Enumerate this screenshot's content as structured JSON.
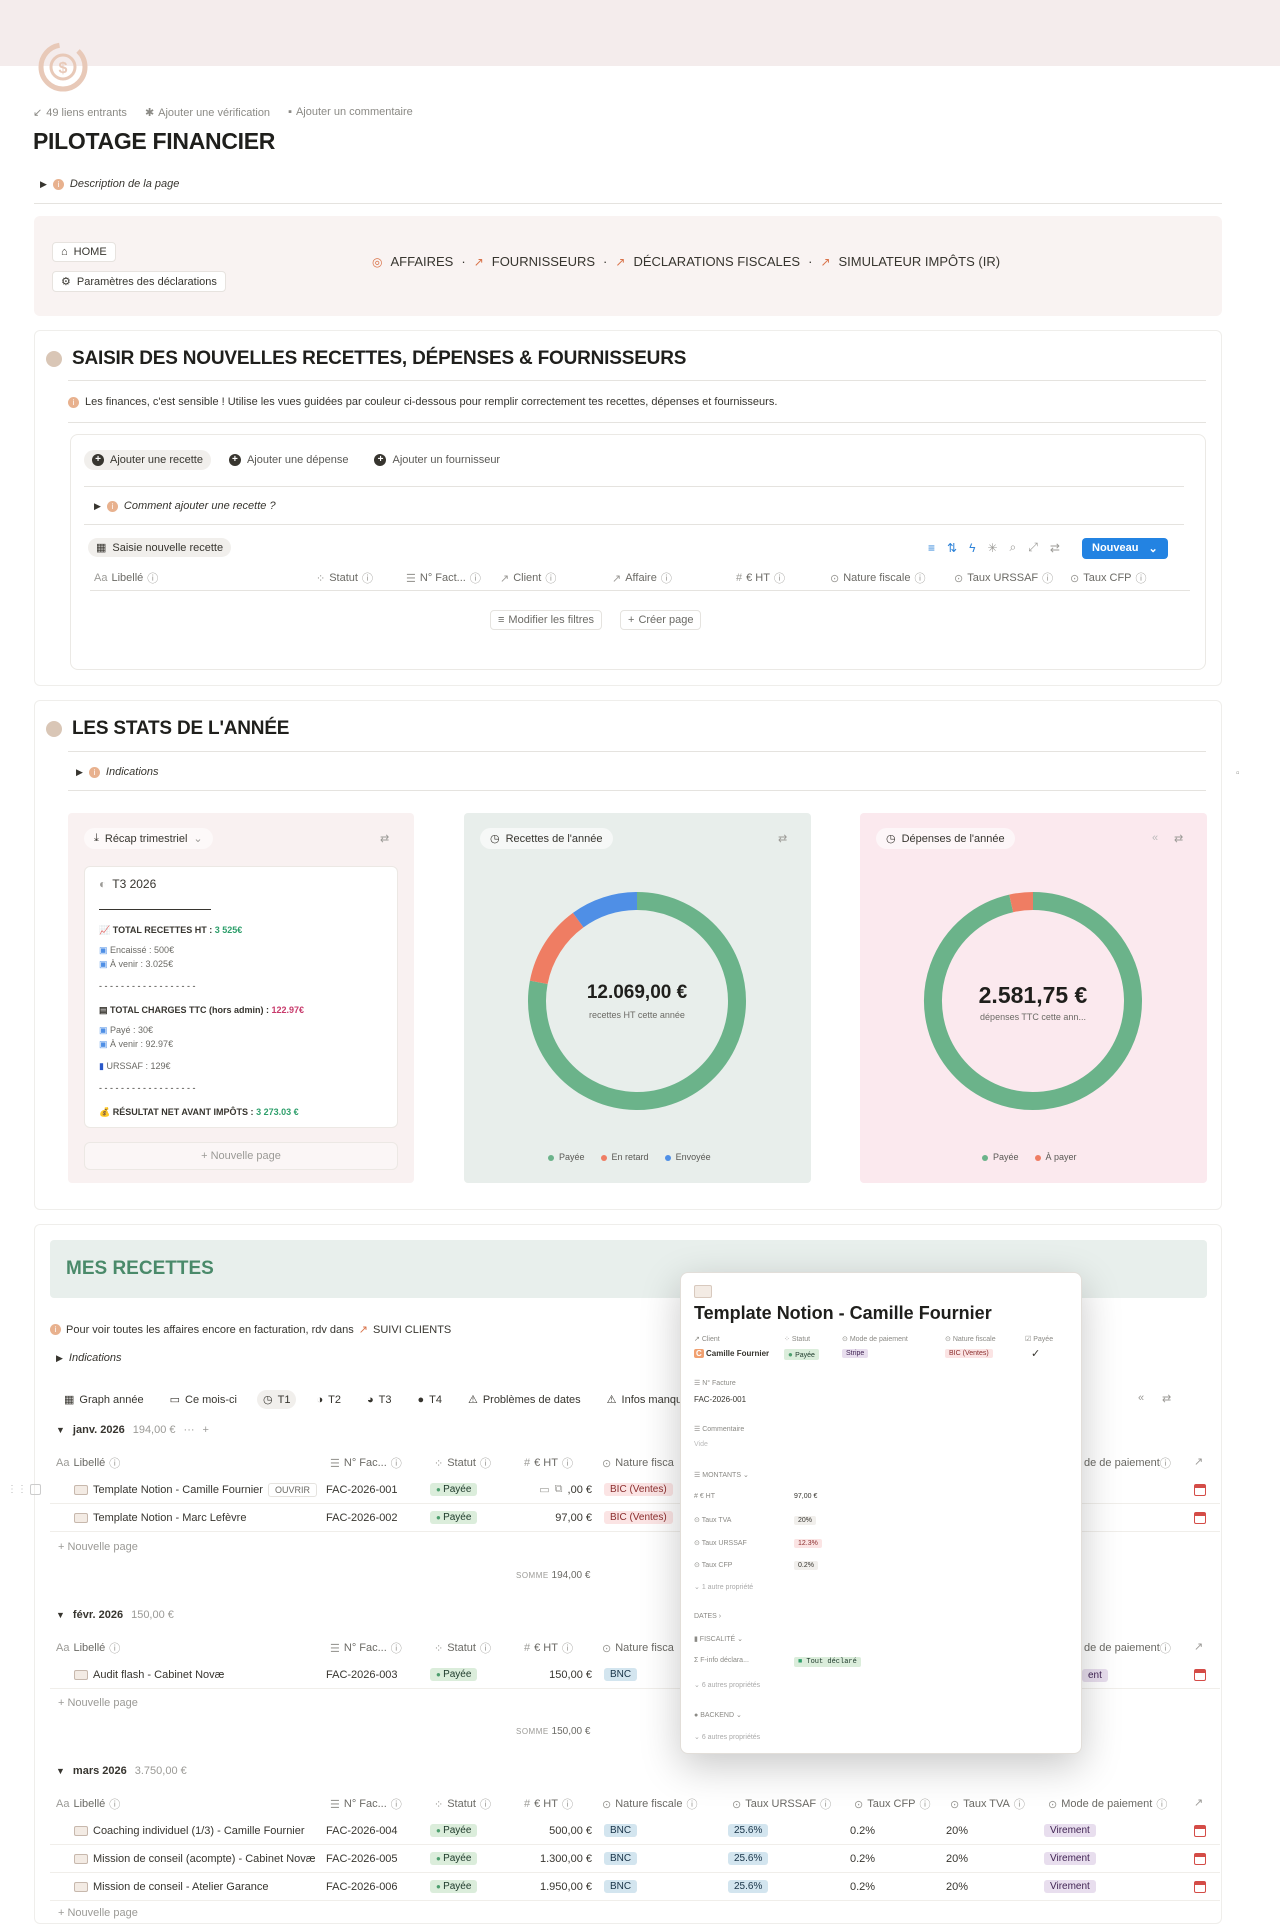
{
  "page": {
    "incoming_links": "49 liens entrants",
    "add_verification": "Ajouter une vérification",
    "add_comment": "Ajouter un commentaire",
    "title": "PILOTAGE FINANCIER",
    "description_toggle": "Description de la page"
  },
  "nav": {
    "home": "HOME",
    "settings": "Paramètres des déclarations",
    "links": [
      "AFFAIRES",
      "FOURNISSEURS",
      "DÉCLARATIONS FISCALES",
      "SIMULATEUR IMPÔTS (IR)"
    ],
    "separator": "·"
  },
  "saisie": {
    "title": "SAISIR DES NOUVELLES RECETTES, DÉPENSES & FOURNISSEURS",
    "callout": "Les finances, c'est sensible ! Utilise les vues guidées par couleur ci-dessous pour remplir correctement tes recettes, dépenses et fournisseurs.",
    "buttons": [
      "Ajouter une recette",
      "Ajouter une dépense",
      "Ajouter un fournisseur"
    ],
    "howto": "Comment ajouter une recette ?",
    "view_label": "Saisie nouvelle recette",
    "new_button": "Nouveau",
    "columns": [
      "Libellé",
      "Statut",
      "N° Fact...",
      "Client",
      "Affaire",
      "€ HT",
      "Nature fiscale",
      "Taux URSSAF",
      "Taux CFP"
    ],
    "modify_filters": "Modifier les filtres",
    "create_page": "Créer page"
  },
  "stats": {
    "title": "LES STATS DE L'ANNÉE",
    "indications": "Indications",
    "recap": {
      "label": "Récap trimestriel",
      "card_title": "T3 2026",
      "total_recettes_label": "TOTAL RECETTES HT : ",
      "total_recettes_value": "3 525€",
      "encaisse": "Encaissé : 500€",
      "a_venir_1": "À venir : 3.025€",
      "dashes": "- - - - - - - - - - - - - - - - - -",
      "total_charges_label": "TOTAL CHARGES TTC (hors admin) : ",
      "total_charges_value": "122.97€",
      "paye": "Payé : 30€",
      "a_venir_2": "À venir : 92.97€",
      "urssaf": "URSSAF : 129€",
      "resultat_label": "RÉSULTAT NET AVANT IMPÔTS : ",
      "resultat_value": "3 273.03 €",
      "new_page": "Nouvelle page"
    },
    "recettes": {
      "label": "Recettes de l'année",
      "value": "12.069,00 €",
      "sub": "recettes HT cette année",
      "legend": [
        "Payée",
        "En retard",
        "Envoyée"
      ]
    },
    "depenses": {
      "label": "Dépenses de l'année",
      "value": "2.581,75 €",
      "sub": "dépenses TTC cette ann...",
      "legend": [
        "Payée",
        "À payer"
      ]
    },
    "colors": {
      "green": "#6bb38a",
      "red": "#ef7d63",
      "blue": "#4f8fe6"
    }
  },
  "chart_data": [
    {
      "type": "pie",
      "title": "Recettes de l'année",
      "categories": [
        "Payée",
        "En retard",
        "Envoyée"
      ],
      "values": [
        0.78,
        0.12,
        0.1
      ],
      "center_label": "12.069,00 €"
    },
    {
      "type": "pie",
      "title": "Dépenses de l'année",
      "categories": [
        "Payée",
        "À payer"
      ],
      "values": [
        0.965,
        0.035
      ],
      "center_label": "2.581,75 €"
    }
  ],
  "recettes": {
    "title": "MES RECETTES",
    "callout_prefix": "Pour voir toutes les affaires encore en facturation, rdv dans",
    "callout_link": "SUIVI CLIENTS",
    "indications": "Indications",
    "views": [
      "Graph année",
      "Ce mois-ci",
      "T1",
      "T2",
      "T3",
      "T4",
      "Problèmes de dates",
      "Infos manqua"
    ],
    "columns": [
      "Libellé",
      "N° Fac...",
      "Statut",
      "€ HT",
      "Nature fisca",
      "de de paiement"
    ],
    "columns_full": [
      "Libellé",
      "N° Fac...",
      "Statut",
      "€ HT",
      "Nature fiscale",
      "Taux URSSAF",
      "Taux CFP",
      "Taux TVA",
      "Mode de paiement"
    ],
    "open_label": "OUVRIR",
    "new_page": "Nouvelle page",
    "somme_label": "SOMME",
    "groups": [
      {
        "name": "janv. 2026",
        "total": "194,00 €",
        "somme": "194,00 €",
        "rows": [
          {
            "libelle": "Template Notion - Camille Fournier",
            "num": "FAC-2026-001",
            "statut": "Payée",
            "ht": ",00 €",
            "nature": "BIC (Ventes)"
          },
          {
            "libelle": "Template Notion - Marc Lefèvre",
            "num": "FAC-2026-002",
            "statut": "Payée",
            "ht": "97,00 €",
            "nature": "BIC (Ventes)"
          }
        ]
      },
      {
        "name": "févr. 2026",
        "total": "150,00 €",
        "somme": "150,00 €",
        "rows": [
          {
            "libelle": "Audit flash - Cabinet Novæ",
            "num": "FAC-2026-003",
            "statut": "Payée",
            "ht": "150,00 €",
            "nature": "BNC",
            "mode": "ent"
          }
        ]
      },
      {
        "name": "mars 2026",
        "total": "3.750,00 €",
        "rows": [
          {
            "libelle": "Coaching individuel (1/3) - Camille Fournier",
            "num": "FAC-2026-004",
            "statut": "Payée",
            "ht": "500,00 €",
            "nature": "BNC",
            "urssaf": "25.6%",
            "cfp": "0.2%",
            "tva": "20%",
            "mode": "Virement"
          },
          {
            "libelle": "Mission de conseil (acompte) - Cabinet Novæ",
            "num": "FAC-2026-005",
            "statut": "Payée",
            "ht": "1.300,00 €",
            "nature": "BNC",
            "urssaf": "25.6%",
            "cfp": "0.2%",
            "tva": "20%",
            "mode": "Virement"
          },
          {
            "libelle": "Mission de conseil - Atelier Garance",
            "num": "FAC-2026-006",
            "statut": "Payée",
            "ht": "1.950,00 €",
            "nature": "BNC",
            "urssaf": "25.6%",
            "cfp": "0.2%",
            "tva": "20%",
            "mode": "Virement"
          }
        ]
      }
    ]
  },
  "popup": {
    "title": "Template Notion - Camille Fournier",
    "props": [
      "Client",
      "Statut",
      "Mode de paiement",
      "Nature fiscale",
      "Payée"
    ],
    "client": "Camille Fournier",
    "statut": "Payée",
    "mode": "Stripe",
    "nature": "BIC (Ventes)",
    "check": "✓",
    "num_label": "N° Facture",
    "num": "FAC-2026-001",
    "comment_label": "Commentaire",
    "comment": "Vide",
    "montants": "MONTANTS",
    "ht_label": "€ HT",
    "ht": "97,00 €",
    "tva_label": "Taux TVA",
    "tva": "20%",
    "urssaf_label": "Taux URSSAF",
    "urssaf": "12.3%",
    "cfp_label": "Taux CFP",
    "cfp": "0.2%",
    "more1": "1 autre propriété",
    "dates": "DATES",
    "fiscalite": "FISCALITÉ",
    "finfo_label": "F-info déclara...",
    "finfo": "Tout déclaré",
    "more6a": "6 autres propriétés",
    "backend": "BACKEND",
    "more6b": "6 autres propriétés"
  }
}
